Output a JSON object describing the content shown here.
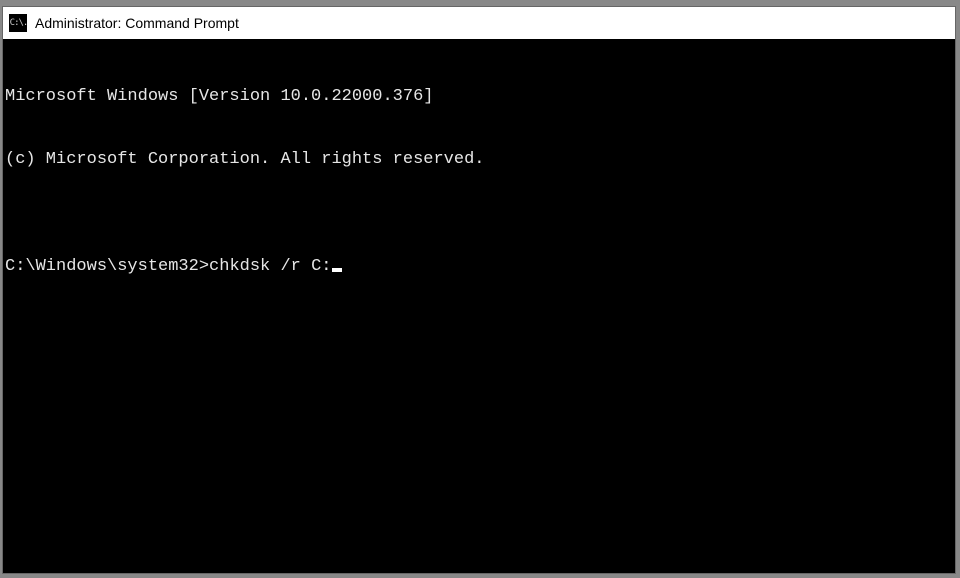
{
  "titlebar": {
    "icon_text": "C:\\.",
    "title": "Administrator: Command Prompt"
  },
  "terminal": {
    "line1": "Microsoft Windows [Version 10.0.22000.376]",
    "line2": "(c) Microsoft Corporation. All rights reserved.",
    "blank": "",
    "prompt": "C:\\Windows\\system32>",
    "command": "chkdsk /r C:"
  }
}
